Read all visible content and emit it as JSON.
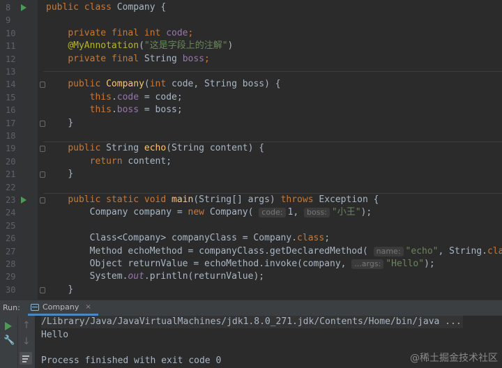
{
  "editor": {
    "line_numbers": [
      "8",
      "9",
      "10",
      "11",
      "12",
      "13",
      "14",
      "15",
      "16",
      "17",
      "18",
      "19",
      "20",
      "21",
      "22",
      "23",
      "24",
      "25",
      "26",
      "27",
      "28",
      "29",
      "30"
    ],
    "l8": {
      "kw1": "public class",
      "rest": " Company {"
    },
    "l10": {
      "kw": "private final int",
      "field": "code",
      "end": ";"
    },
    "l11": {
      "ann": "@MyAnnotation",
      "open": "(",
      "str": "\"这是字段上的注解\"",
      "close": ")"
    },
    "l12": {
      "kw": "private final",
      "type": " String ",
      "field": "boss",
      "end": ";"
    },
    "l14": {
      "kw": "public",
      "fn": "Company",
      "p1": "(",
      "kw2": "int",
      "rest": " code, String boss) {"
    },
    "l15": {
      "kw": "this",
      "dot": ".",
      "field": "code",
      "rest": " = code;"
    },
    "l16": {
      "kw": "this",
      "dot": ".",
      "field": "boss",
      "rest": " = boss;"
    },
    "l17": {
      "text": "}"
    },
    "l19": {
      "kw": "public",
      "type": " String ",
      "fn": "echo",
      "rest": "(String content) {"
    },
    "l20": {
      "kw": "return",
      "rest": " content;"
    },
    "l21": {
      "text": "}"
    },
    "l23": {
      "kw": "public static void",
      "fn": "main",
      "rest": "(String[] args) ",
      "kw2": "throws",
      "rest2": " Exception {"
    },
    "l24": {
      "pre": "Company company = ",
      "kw": "new",
      "mid": " Company( ",
      "hint1": "code:",
      "val1": "1, ",
      "hint2": "boss:",
      "str": "\"小王\"",
      "end": ");"
    },
    "l26": {
      "pre": "Class<Company> companyClass = Company.",
      "kw": "class",
      "end": ";"
    },
    "l27": {
      "pre": "Method echoMethod = companyClass.getDeclaredMethod( ",
      "hint": "name:",
      "str": "\"echo\"",
      "mid": ", String.",
      "kw": "class",
      "end": ");"
    },
    "l28": {
      "pre": "Object returnValue = echoMethod.invoke(company, ",
      "hint": "...args:",
      "str": "\"Hello\"",
      "end": ");"
    },
    "l29": {
      "pre": "System.",
      "static": "out",
      "end": ".println(returnValue);"
    },
    "l30": {
      "text": "}"
    }
  },
  "run_panel": {
    "label": "Run:",
    "tab_label": "Company",
    "close_glyph": "×",
    "console_lines": {
      "command": "/Library/Java/JavaVirtualMachines/jdk1.8.0_271.jdk/Contents/Home/bin/java ...",
      "output": "Hello",
      "exit": "Process finished with exit code 0"
    }
  },
  "icons": {
    "run_gutter": "run-triangle-icon",
    "rerun": "play-icon",
    "up": "arrow-up-icon",
    "down": "arrow-down-icon",
    "settings": "wrench-icon",
    "soft_wrap": "soft-wrap-icon"
  },
  "watermark": "@稀土掘金技术社区",
  "colors": {
    "background": "#2b2b2b",
    "keyword": "#cc7832",
    "string": "#6a8759",
    "field": "#9876aa",
    "function": "#ffc66d",
    "annotation": "#bbb529",
    "run_green": "#499c54"
  }
}
